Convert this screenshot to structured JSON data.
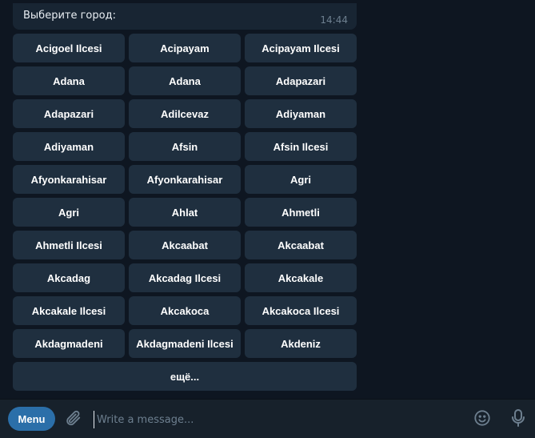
{
  "message": {
    "text": "Выберите город:",
    "time": "14:44"
  },
  "keyboard": {
    "rows": [
      [
        "Acigoel Ilcesi",
        "Acipayam",
        "Acipayam Ilcesi"
      ],
      [
        "Adana",
        "Adana",
        "Adapazari"
      ],
      [
        "Adapazari",
        "Adilcevaz",
        "Adiyaman"
      ],
      [
        "Adiyaman",
        "Afsin",
        "Afsin Ilcesi"
      ],
      [
        "Afyonkarahisar",
        "Afyonkarahisar",
        "Agri"
      ],
      [
        "Agri",
        "Ahlat",
        "Ahmetli"
      ],
      [
        "Ahmetli Ilcesi",
        "Akcaabat",
        "Akcaabat"
      ],
      [
        "Akcadag",
        "Akcadag Ilcesi",
        "Akcakale"
      ],
      [
        "Akcakale Ilcesi",
        "Akcakoca",
        "Akcakoca Ilcesi"
      ],
      [
        "Akdagmadeni",
        "Akdagmadeni Ilcesi",
        "Akdeniz"
      ]
    ],
    "more": "ещё..."
  },
  "composer": {
    "menu_label": "Menu",
    "placeholder": "Write a message...",
    "icons": [
      "paperclip-icon",
      "emoji-icon",
      "microphone-icon"
    ]
  },
  "colors": {
    "background": "#0e1621",
    "bubble": "#182533",
    "button": "#1f2f3f",
    "accent": "#2b6fa9"
  }
}
